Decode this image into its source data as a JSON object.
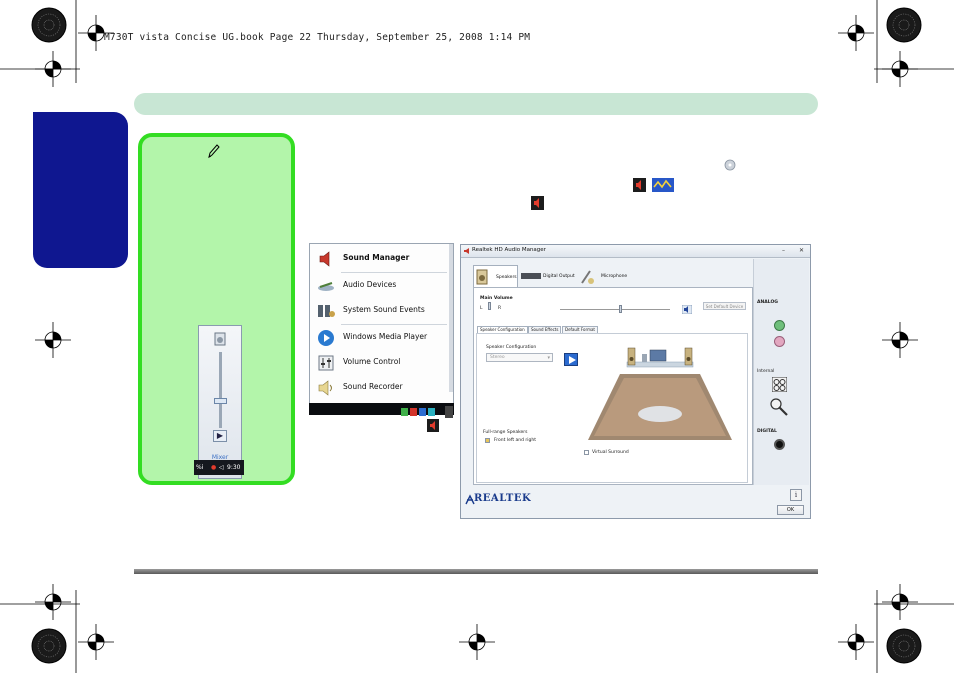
{
  "header": {
    "print_line": "M730T vista Concise UG.book  Page 22  Thursday, September 25, 2008  1:14 PM"
  },
  "volume_mixer": {
    "mixer_label": "Mixer",
    "tray_time": "9:30",
    "tray_left": "%i"
  },
  "start_menu": {
    "items": [
      {
        "label": "Sound Manager",
        "icon": "speaker-icon"
      },
      {
        "label": "Audio Devices",
        "icon": "audio-devices-icon"
      },
      {
        "label": "System Sound Events",
        "icon": "sound-events-icon"
      },
      {
        "label": "Windows Media Player",
        "icon": "media-player-icon"
      },
      {
        "label": "Volume Control",
        "icon": "volume-control-icon"
      },
      {
        "label": "Sound Recorder",
        "icon": "sound-recorder-icon"
      }
    ]
  },
  "realtek": {
    "window_title": "Realtek HD Audio Manager",
    "tabs": [
      "Speakers",
      "Digital Output",
      "Microphone"
    ],
    "main_volume": {
      "label": "Main Volume",
      "left": "L",
      "right": "R",
      "level": 0.55
    },
    "set_default_label": "Set Default Device",
    "subtabs": [
      "Speaker Configuration",
      "Sound Effects",
      "Default Format"
    ],
    "speaker_config_label": "Speaker Configuration",
    "speaker_config_value": "Stereo",
    "fullrange_label": "Full-range Speakers",
    "fullrange_option": "Front left and right",
    "virtual_surround": "Virtual Surround",
    "side": {
      "analog": "ANALOG",
      "internal": "Internal",
      "digital": "DIGITAL"
    },
    "logo": "REALTEK",
    "ok": "OK",
    "info": "i"
  },
  "colors": {
    "sidetab": "#0f1790",
    "topbar": "#c8e6d4",
    "note_fill": "#b3f5aa",
    "note_border": "#33dd22"
  }
}
